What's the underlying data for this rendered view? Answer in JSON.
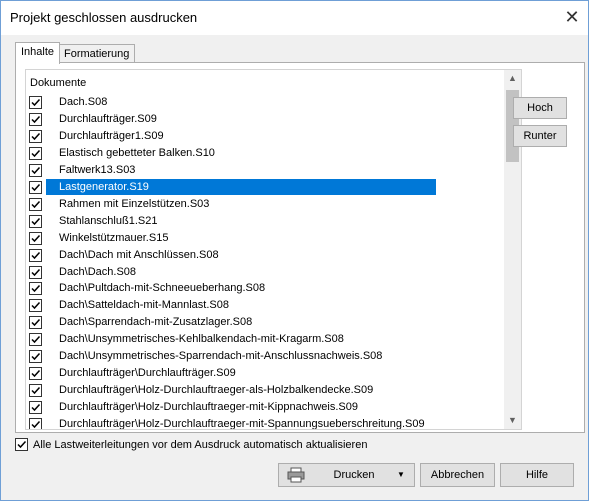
{
  "window": {
    "title": "Projekt geschlossen ausdrucken"
  },
  "tabs": [
    "Inhalte",
    "Formatierung"
  ],
  "list": {
    "header": "Dokumente",
    "items": [
      {
        "label": "Dach.S08",
        "checked": true
      },
      {
        "label": "Durchlaufträger.S09",
        "checked": true
      },
      {
        "label": "Durchlaufträger1.S09",
        "checked": true
      },
      {
        "label": "Elastisch gebetteter Balken.S10",
        "checked": true
      },
      {
        "label": "Faltwerk13.S03",
        "checked": true
      },
      {
        "label": "Lastgenerator.S19",
        "checked": true,
        "selected": true
      },
      {
        "label": "Rahmen mit Einzelstützen.S03",
        "checked": true
      },
      {
        "label": "Stahlanschluß1.S21",
        "checked": true
      },
      {
        "label": "Winkelstützmauer.S15",
        "checked": true
      },
      {
        "label": "Dach\\Dach mit Anschlüssen.S08",
        "checked": true
      },
      {
        "label": "Dach\\Dach.S08",
        "checked": true
      },
      {
        "label": "Dach\\Pultdach-mit-Schneeueberhang.S08",
        "checked": true
      },
      {
        "label": "Dach\\Satteldach-mit-Mannlast.S08",
        "checked": true
      },
      {
        "label": "Dach\\Sparrendach-mit-Zusatzlager.S08",
        "checked": true
      },
      {
        "label": "Dach\\Unsymmetrisches-Kehlbalkendach-mit-Kragarm.S08",
        "checked": true
      },
      {
        "label": "Dach\\Unsymmetrisches-Sparrendach-mit-Anschlussnachweis.S08",
        "checked": true
      },
      {
        "label": "Durchlaufträger\\Durchlaufträger.S09",
        "checked": true
      },
      {
        "label": "Durchlaufträger\\Holz-Durchlauftraeger-als-Holzbalkendecke.S09",
        "checked": true
      },
      {
        "label": "Durchlaufträger\\Holz-Durchlauftraeger-mit-Kippnachweis.S09",
        "checked": true
      },
      {
        "label": "Durchlaufträger\\Holz-Durchlauftraeger-mit-Spannungsueberschreitung.S09",
        "checked": true
      }
    ]
  },
  "buttons": {
    "hoch": "Hoch",
    "runter": "Runter",
    "drucken": "Drucken",
    "abbrechen": "Abbrechen",
    "hilfe": "Hilfe"
  },
  "auto_update": {
    "label": "Alle Lastweiterleitungen vor dem Ausdruck automatisch aktualisieren",
    "checked": true
  },
  "icons": {
    "close": "close-icon",
    "printer": "printer-icon",
    "dropdown": "chevron-down-icon",
    "scroll_up": "scroll-up-icon",
    "scroll_down": "scroll-down-icon",
    "check": "check-icon"
  },
  "colors": {
    "selection": "#0078d7",
    "window_border": "#6f9fd6"
  }
}
